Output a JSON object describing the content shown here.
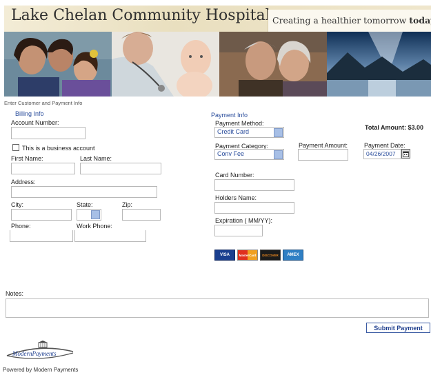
{
  "header": {
    "hospital_name": "Lake Chelan Community Hospital",
    "tagline_prefix": "Creating a healthier tomorrow",
    "tagline_emph": "today."
  },
  "page_intro": "Enter Customer and Payment Info",
  "billing": {
    "section_title": "Billing Info",
    "account_number_label": "Account Number:",
    "business_account_label": "This is a business account",
    "first_name_label": "First Name:",
    "last_name_label": "Last Name:",
    "address_label": "Address:",
    "city_label": "City:",
    "state_label": "State:",
    "zip_label": "Zip:",
    "phone_label": "Phone:",
    "work_phone_label": "Work Phone:"
  },
  "payment": {
    "section_title": "Payment Info",
    "method_label": "Payment Method:",
    "method_value": "Credit Card",
    "category_label": "Payment Category:",
    "category_value": "Conv Fee",
    "amount_label": "Payment Amount:",
    "date_label": "Payment Date:",
    "date_value": "04/26/2007",
    "total_label": "Total Amount: $3.00",
    "card_number_label": "Card Number:",
    "holder_name_label": "Holders Name:",
    "expiration_label": "Expiration ( MM/YY):",
    "cards": [
      "VISA",
      "MasterCard",
      "DISCOVER",
      "AMEX"
    ]
  },
  "notes_label": "Notes:",
  "submit_label": "Submit Payment",
  "footer": {
    "logo_text": "ModernPayments",
    "powered_by": "Powered by Modern Payments"
  },
  "colors": {
    "accent_blue": "#2a4d9c",
    "dropdown_blue": "#a7bfe6",
    "banner_beige": "#efe6cc"
  }
}
